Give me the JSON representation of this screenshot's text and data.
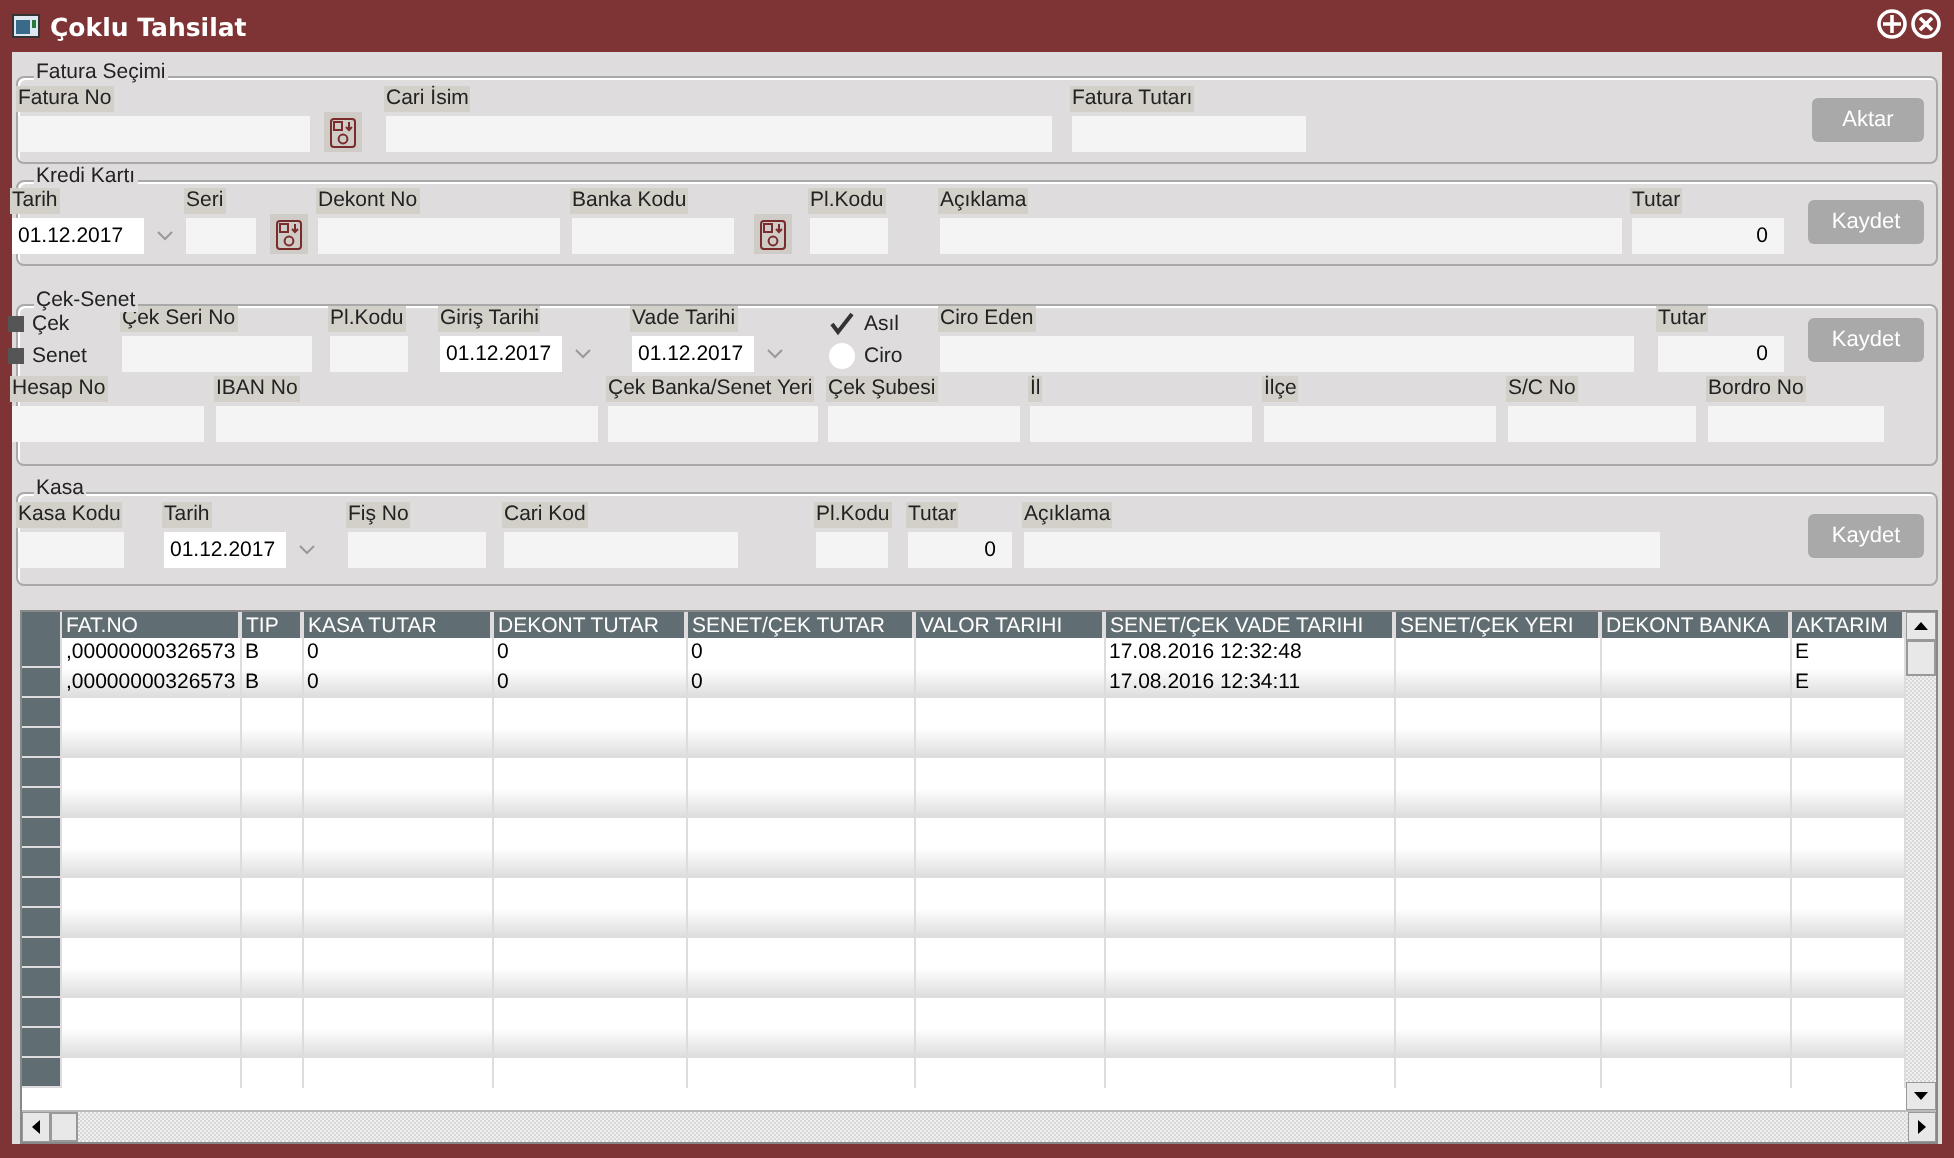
{
  "window": {
    "title": "Çoklu Tahsilat"
  },
  "sections": [
    {
      "legend": "Fatura Seçimi",
      "lines": [
        [
          {
            "kind": "field",
            "label": "Fatura No"
          },
          {
            "kind": "lookup"
          },
          {
            "kind": "field",
            "label": "Cari İsim"
          },
          {
            "kind": "field",
            "label": "Fatura Tutarı"
          },
          {
            "kind": "button",
            "label": "Aktar"
          }
        ]
      ]
    },
    {
      "legend": "Kredi Kartı",
      "lines": [
        [
          {
            "kind": "date",
            "label": "Tarih",
            "value": "01.12.2017"
          },
          {
            "kind": "field",
            "label": "Seri"
          },
          {
            "kind": "lookup"
          },
          {
            "kind": "field",
            "label": "Dekont No"
          },
          {
            "kind": "field",
            "label": "Banka Kodu"
          },
          {
            "kind": "lookup"
          },
          {
            "kind": "field",
            "label": "Pl.Kodu"
          },
          {
            "kind": "field",
            "label": "Açıklama"
          },
          {
            "kind": "field",
            "label": "Tutar",
            "value": "0"
          },
          {
            "kind": "button",
            "label": "Kaydet"
          }
        ]
      ]
    },
    {
      "legend": "Çek-Senet",
      "lines": [
        [
          {
            "kind": "checks",
            "options": [
              {
                "label": "Çek",
                "checked": false
              },
              {
                "label": "Senet",
                "checked": false
              }
            ]
          },
          {
            "kind": "field",
            "label": "Çek Seri No"
          },
          {
            "kind": "field",
            "label": "Pl.Kodu"
          },
          {
            "kind": "date",
            "label": "Giriş Tarihi",
            "value": "01.12.2017"
          },
          {
            "kind": "date",
            "label": "Vade Tarihi",
            "value": "01.12.2017"
          },
          {
            "kind": "checks",
            "options": [
              {
                "label": "Asıl",
                "checked": true
              },
              {
                "label": "Ciro",
                "checked": false
              }
            ]
          },
          {
            "kind": "field",
            "label": "Ciro Eden"
          },
          {
            "kind": "field",
            "label": "Tutar",
            "value": "0"
          },
          {
            "kind": "button",
            "label": "Kaydet"
          }
        ],
        [
          {
            "kind": "field",
            "label": "Hesap No"
          },
          {
            "kind": "field",
            "label": "IBAN No"
          },
          {
            "kind": "field",
            "label": "Çek Banka/Senet Yeri"
          },
          {
            "kind": "field",
            "label": "Çek Şubesi"
          },
          {
            "kind": "field",
            "label": "İl"
          },
          {
            "kind": "field",
            "label": "İlçe"
          },
          {
            "kind": "field",
            "label": "S/C No"
          },
          {
            "kind": "field",
            "label": "Bordro No"
          }
        ]
      ]
    },
    {
      "legend": "Kasa",
      "lines": [
        [
          {
            "kind": "field",
            "label": "Kasa Kodu"
          },
          {
            "kind": "date",
            "label": "Tarih",
            "value": "01.12.2017"
          },
          {
            "kind": "field",
            "label": "Fiş No"
          },
          {
            "kind": "field",
            "label": "Cari Kod"
          },
          {
            "kind": "field",
            "label": "Pl.Kodu"
          },
          {
            "kind": "field",
            "label": "Tutar",
            "value": "0"
          },
          {
            "kind": "field",
            "label": "Açıklama"
          },
          {
            "kind": "button",
            "label": "Kaydet"
          }
        ]
      ]
    }
  ],
  "table": {
    "columns": [
      "FAT.NO",
      "TIP",
      "KASA TUTAR",
      "DEKONT TUTAR",
      "SENET/ÇEK TUTAR",
      "VALOR TARIHI",
      "SENET/ÇEK VADE TARIHI",
      "SENET/ÇEK YERI",
      "DEKONT BANKA",
      "AKTARIM"
    ],
    "rows": [
      [
        ",00000000326573",
        "B",
        "0",
        "0",
        "0",
        "",
        "17.08.2016 12:32:48",
        "",
        "",
        "E"
      ],
      [
        ",00000000326573",
        "B",
        "0",
        "0",
        "0",
        "",
        "17.08.2016 12:34:11",
        "",
        "",
        "E"
      ]
    ]
  }
}
